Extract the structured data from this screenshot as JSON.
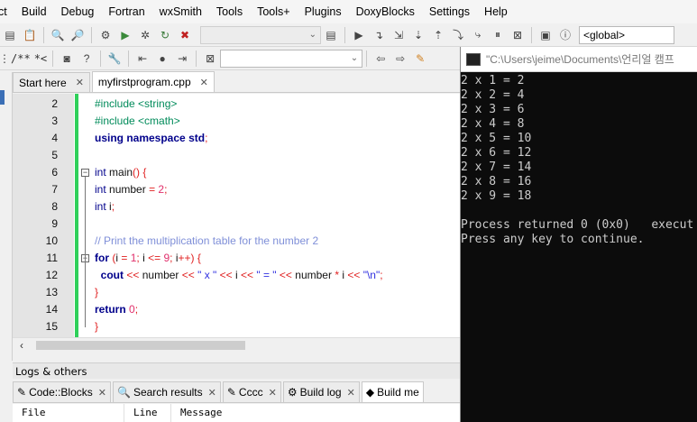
{
  "menu": [
    "ct",
    "Build",
    "Debug",
    "Fortran",
    "wxSmith",
    "Tools",
    "Tools+",
    "Plugins",
    "DoxyBlocks",
    "Settings",
    "Help"
  ],
  "toolbar": {
    "scope_value": "<global>",
    "comment_block": "/**",
    "comment_line": "*<"
  },
  "editor_tabs": [
    {
      "label": "Start here",
      "active": false
    },
    {
      "label": "myfirstprogram.cpp",
      "active": true
    }
  ],
  "code_lines": [
    {
      "n": "2",
      "fold": "",
      "html": "<span class=\"pp\">#include &lt;string&gt;</span>"
    },
    {
      "n": "3",
      "fold": "",
      "html": "<span class=\"pp\">#include &lt;cmath&gt;</span>"
    },
    {
      "n": "4",
      "fold": "",
      "html": "<span class=\"k\">using namespace</span> <span class=\"k\">std</span><span class=\"op\">;</span>"
    },
    {
      "n": "5",
      "fold": "",
      "html": ""
    },
    {
      "n": "6",
      "fold": "box",
      "html": "<span class=\"t\">int</span> <span class=\"pl\">main</span><span class=\"op\">() {</span>"
    },
    {
      "n": "7",
      "fold": "",
      "html": "<span class=\"t\">int</span> <span class=\"pl\">number</span> <span class=\"op\">=</span> <span class=\"num\">2</span><span class=\"op\">;</span>"
    },
    {
      "n": "8",
      "fold": "",
      "html": "<span class=\"t\">int</span> <span class=\"pl\">i</span><span class=\"op\">;</span>"
    },
    {
      "n": "9",
      "fold": "",
      "html": ""
    },
    {
      "n": "10",
      "fold": "",
      "html": "<span class=\"cm\">// Print the multiplication table for the number 2</span>"
    },
    {
      "n": "11",
      "fold": "box",
      "html": "<span class=\"k\">for</span> <span class=\"op\">(</span><span class=\"pl\">i</span> <span class=\"op\">=</span> <span class=\"num\">1</span><span class=\"op\">;</span> <span class=\"pl\">i</span> <span class=\"op\">&lt;=</span> <span class=\"num\">9</span><span class=\"op\">;</span> <span class=\"pl\">i</span><span class=\"op\">++) {</span>"
    },
    {
      "n": "12",
      "fold": "",
      "html": "  <span class=\"k\">cout</span> <span class=\"op\">&lt;&lt;</span> <span class=\"pl\">number</span> <span class=\"op\">&lt;&lt;</span> <span class=\"str\">\" x \"</span> <span class=\"op\">&lt;&lt;</span> <span class=\"pl\">i</span> <span class=\"op\">&lt;&lt;</span> <span class=\"str\">\" = \"</span> <span class=\"op\">&lt;&lt;</span> <span class=\"pl\">number</span> <span class=\"op\">*</span> <span class=\"pl\">i</span> <span class=\"op\">&lt;&lt;</span> <span class=\"str\">\"\\n\"</span><span class=\"op\">;</span>"
    },
    {
      "n": "13",
      "fold": "end",
      "html": "<span class=\"op\">}</span>"
    },
    {
      "n": "14",
      "fold": "",
      "html": "<span class=\"k\">return</span> <span class=\"num\">0</span><span class=\"op\">;</span>"
    },
    {
      "n": "15",
      "fold": "end",
      "html": "<span class=\"op\">}</span>"
    }
  ],
  "logs": {
    "title": "Logs & others",
    "tabs": [
      {
        "label": "Code::Blocks",
        "icon": "✎",
        "active": false
      },
      {
        "label": "Search results",
        "icon": "🔍",
        "active": false
      },
      {
        "label": "Cccc",
        "icon": "✎",
        "active": false
      },
      {
        "label": "Build log",
        "icon": "⚙",
        "active": false
      },
      {
        "label": "Build me",
        "icon": "◆",
        "active": true
      }
    ],
    "columns": [
      "File",
      "Line",
      "Message"
    ]
  },
  "console": {
    "title": "\"C:\\Users\\jeime\\Documents\\언리얼 캠프",
    "lines": [
      "2 x 1 = 2",
      "2 x 2 = 4",
      "2 x 3 = 6",
      "2 x 4 = 8",
      "2 x 5 = 10",
      "2 x 6 = 12",
      "2 x 7 = 14",
      "2 x 8 = 16",
      "2 x 9 = 18",
      "",
      "Process returned 0 (0x0)   execut",
      "Press any key to continue."
    ]
  }
}
